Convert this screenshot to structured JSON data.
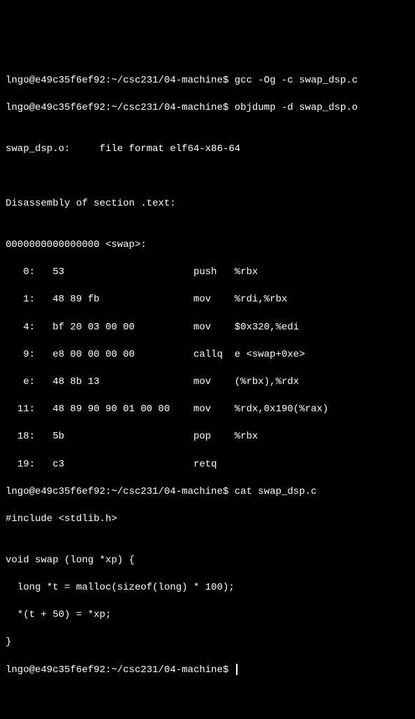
{
  "line1_prompt": "lngo@e49c35f6ef92:~/csc231/04-machine$ ",
  "line1_cmd": "gcc -Og -c swap_dsp.c",
  "line2_prompt": "lngo@e49c35f6ef92:~/csc231/04-machine$ ",
  "line2_cmd": "objdump -d swap_dsp.o",
  "blank": "",
  "file_header": "swap_dsp.o:     file format elf64-x86-64",
  "disasm_header": "Disassembly of section .text:",
  "swap_label": "0000000000000000 <swap>:",
  "inst_0": "   0:   53                      push   %rbx",
  "inst_1": "   1:   48 89 fb                mov    %rdi,%rbx",
  "inst_4": "   4:   bf 20 03 00 00          mov    $0x320,%edi",
  "inst_9": "   9:   e8 00 00 00 00          callq  e <swap+0xe>",
  "inst_e": "   e:   48 8b 13                mov    (%rbx),%rdx",
  "inst_11": "  11:   48 89 90 90 01 00 00    mov    %rdx,0x190(%rax)",
  "inst_18": "  18:   5b                      pop    %rbx",
  "inst_19": "  19:   c3                      retq",
  "line3_prompt": "lngo@e49c35f6ef92:~/csc231/04-machine$ ",
  "line3_cmd": "cat swap_dsp.c",
  "src_1": "#include <stdlib.h>",
  "src_2": "",
  "src_3": "void swap (long *xp) {",
  "src_4": "  long *t = malloc(sizeof(long) * 100);",
  "src_5": "  *(t + 50) = *xp;",
  "src_6": "}",
  "line4_prompt": "lngo@e49c35f6ef92:~/csc231/04-machine$ "
}
